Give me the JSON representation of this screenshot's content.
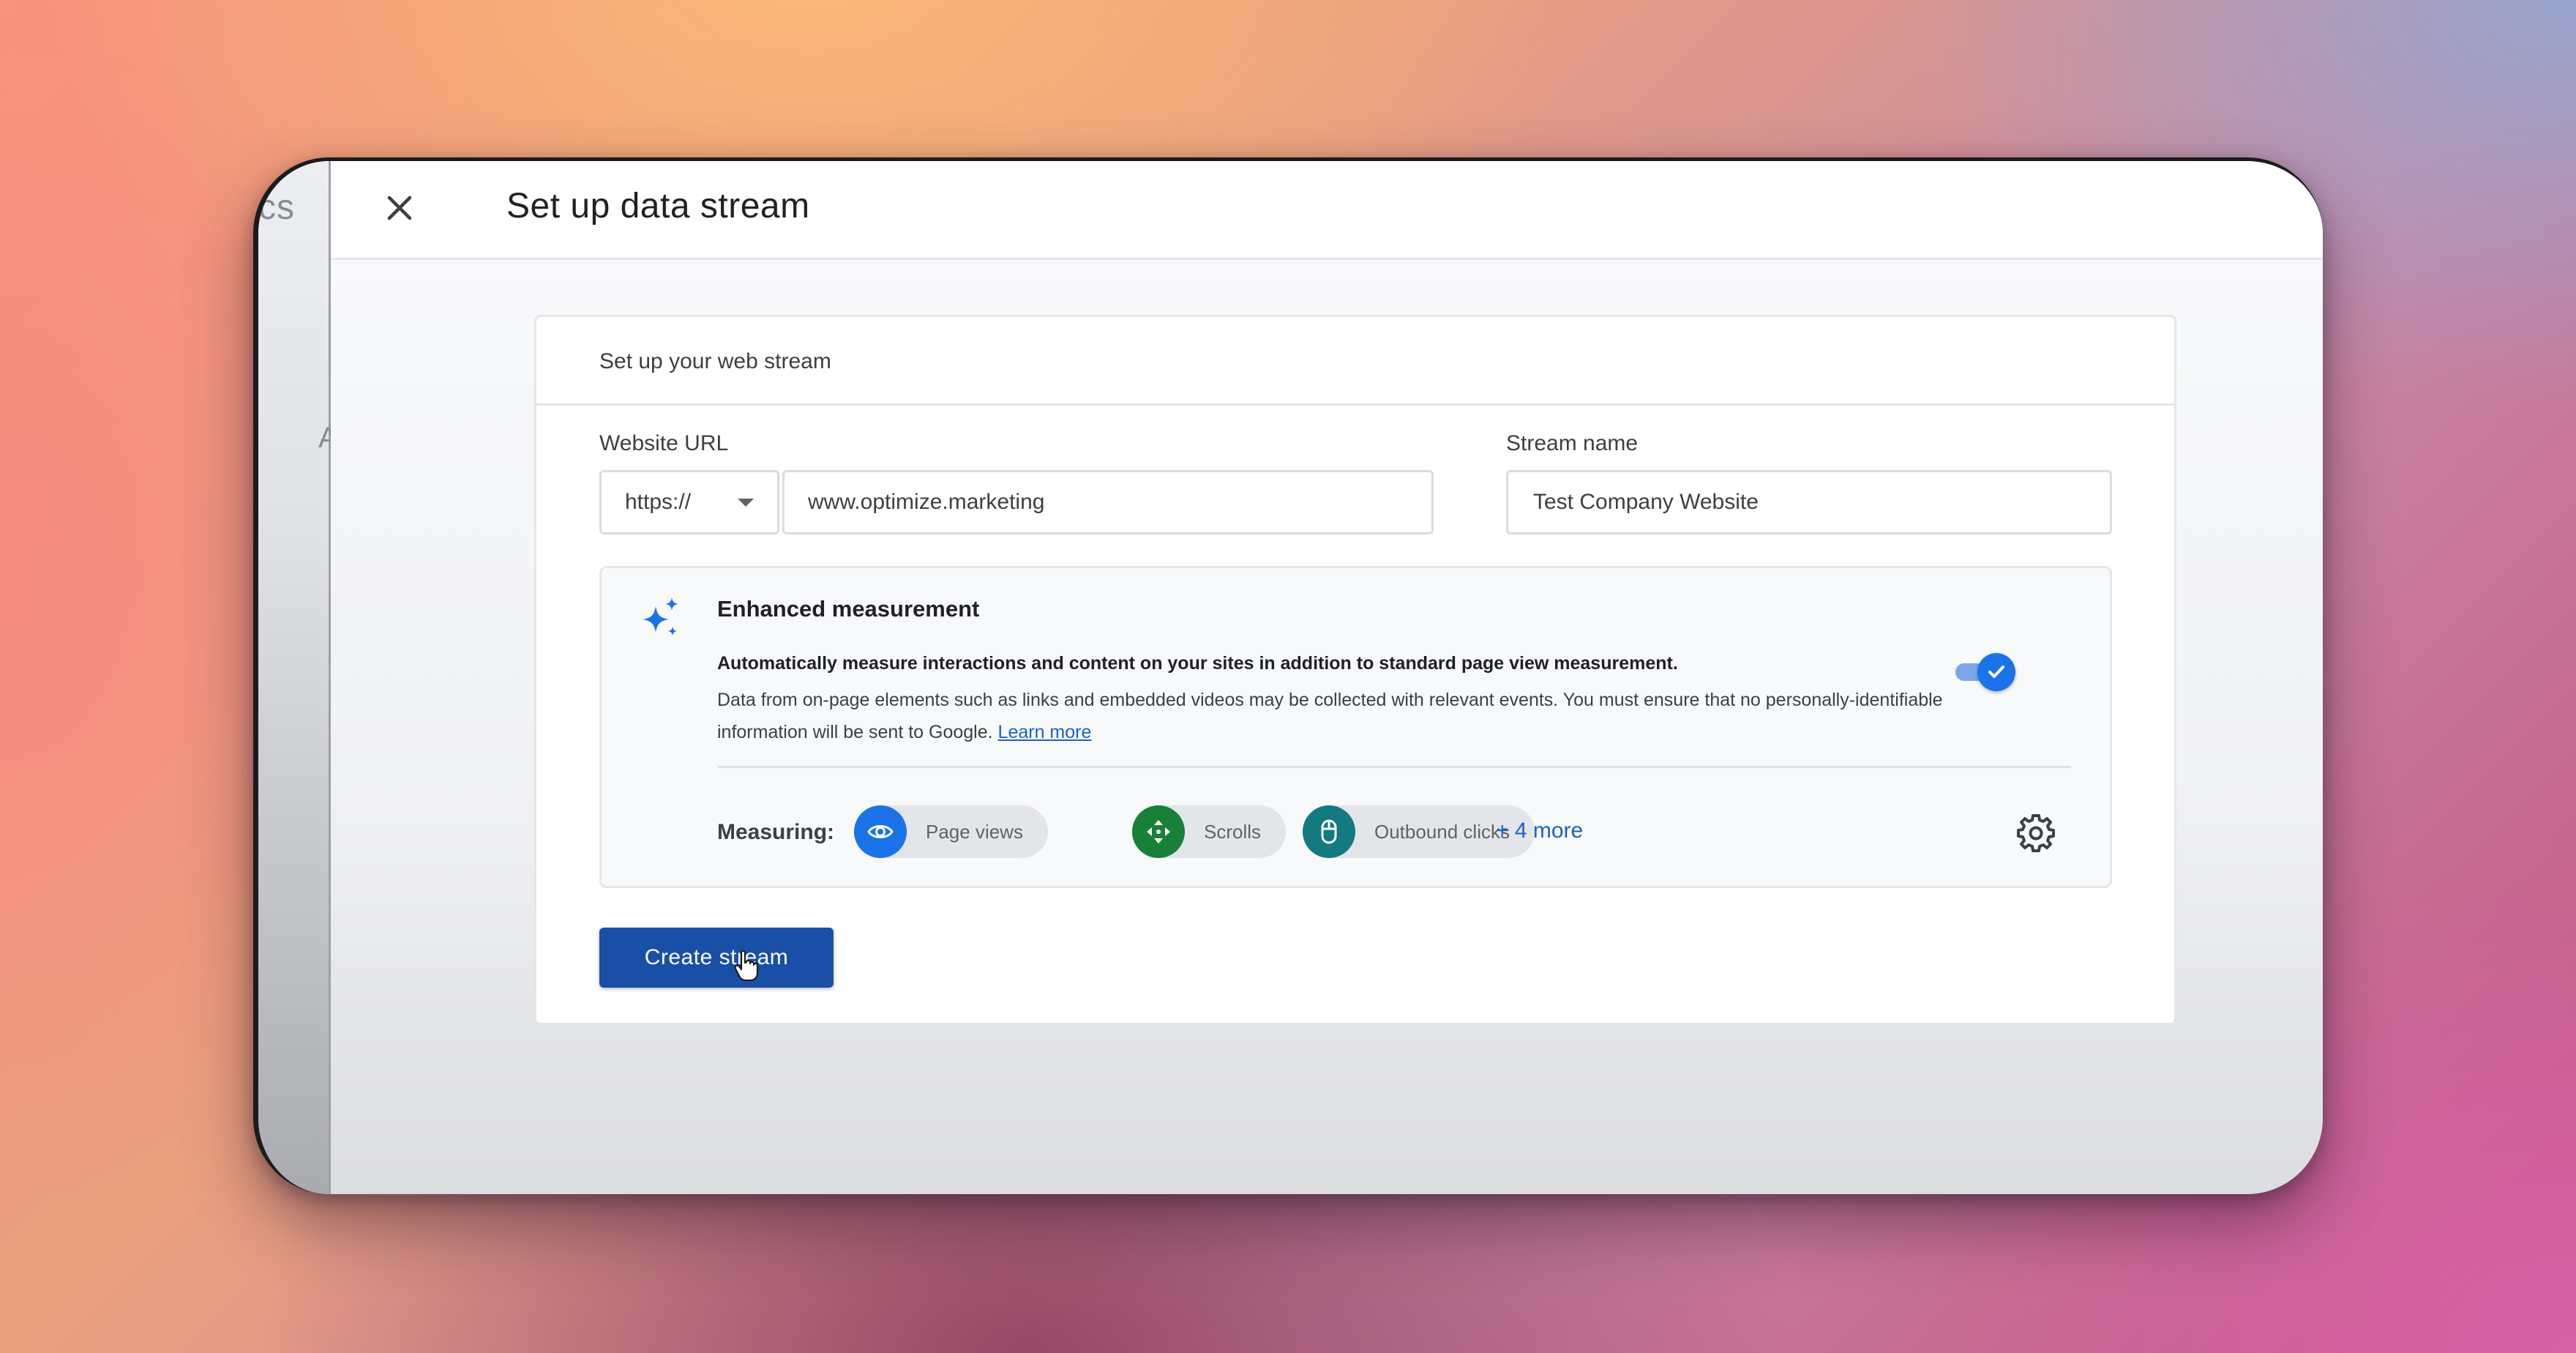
{
  "left_panel": {
    "partial_title": "cs",
    "partial_letter": "A"
  },
  "header": {
    "title": "Set up data stream"
  },
  "card": {
    "heading": "Set up your web stream",
    "website_url": {
      "label": "Website URL",
      "protocol": "https://",
      "value": "www.optimize.marketing"
    },
    "stream_name": {
      "label": "Stream name",
      "value": "Test Company Website"
    },
    "enhanced_measurement": {
      "title": "Enhanced measurement",
      "description_bold": "Automatically measure interactions and content on your sites in addition to standard page view measurement.",
      "description": "Data from on-page elements such as links and embedded videos may be collected with relevant events. You must ensure that no personally-identifiable information will be sent to Google.",
      "learn_more": "Learn more",
      "enabled": true,
      "measuring_label": "Measuring:",
      "chips": [
        {
          "label": "Page views",
          "icon": "eye-icon",
          "color": "#1a73e8"
        },
        {
          "label": "Scrolls",
          "icon": "scroll-icon",
          "color": "#188038"
        },
        {
          "label": "Outbound clicks",
          "icon": "mouse-icon",
          "color": "#137a7f"
        }
      ],
      "more": "+ 4 more"
    },
    "create_button": "Create stream"
  }
}
